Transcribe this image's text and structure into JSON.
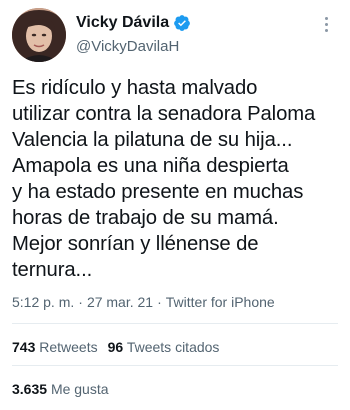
{
  "author": {
    "display_name": "Vicky Dávila",
    "handle": "@VickyDavilaH",
    "verified_color": "#1d9bf0"
  },
  "tweet": {
    "lines": [
      "Es ridículo y hasta malvado",
      "utilizar contra la senadora Paloma",
      "Valencia la pilatuna de su hija...",
      "Amapola es una niña despierta",
      "y ha estado presente en muchas",
      "horas de trabajo de su mamá.",
      "Mejor sonrían y llénense de",
      "ternura..."
    ]
  },
  "meta": {
    "time": "5:12 p. m.",
    "separator": "·",
    "date": "27 mar. 21",
    "source": "Twitter for iPhone"
  },
  "stats": {
    "retweets_count": "743",
    "retweets_label": "Retweets",
    "quotes_count": "96",
    "quotes_label": "Tweets citados",
    "likes_count": "3.635",
    "likes_label": "Me gusta"
  },
  "icons": {
    "more": "more-vertical-icon",
    "verified": "verified-badge-icon"
  }
}
